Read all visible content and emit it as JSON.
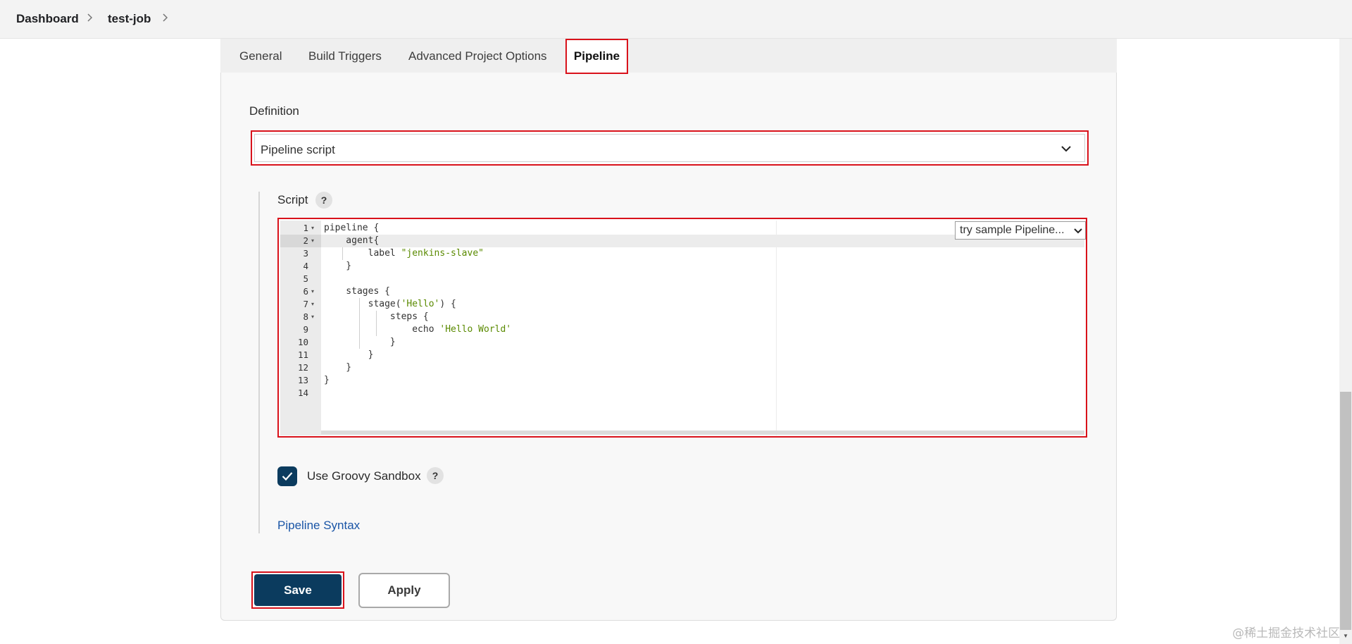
{
  "breadcrumb": {
    "items": [
      "Dashboard",
      "test-job"
    ]
  },
  "tabs": [
    "General",
    "Build Triggers",
    "Advanced Project Options",
    "Pipeline"
  ],
  "active_tab": "Pipeline",
  "definition": {
    "label": "Definition",
    "selected": "Pipeline script"
  },
  "script": {
    "label": "Script",
    "help": "?",
    "sample_select": "try sample Pipeline...",
    "line_numbers": [
      "1",
      "2",
      "3",
      "4",
      "5",
      "6",
      "7",
      "8",
      "9",
      "10",
      "11",
      "12",
      "13",
      "14"
    ],
    "lines": [
      {
        "code": "pipeline {"
      },
      {
        "code": "    agent{"
      },
      {
        "code": "        label ",
        "str": "\"jenkins-slave\""
      },
      {
        "code": "    }"
      },
      {
        "code": ""
      },
      {
        "code": "    stages {"
      },
      {
        "code": "        stage(",
        "str": "'Hello'",
        "tail": ") {"
      },
      {
        "code": "            steps {"
      },
      {
        "code": "                echo ",
        "str": "'Hello World'"
      },
      {
        "code": "            }"
      },
      {
        "code": "        }"
      },
      {
        "code": "    }"
      },
      {
        "code": "}"
      },
      {
        "code": ""
      }
    ]
  },
  "sandbox": {
    "label": "Use Groovy Sandbox",
    "checked": true,
    "help": "?"
  },
  "pipeline_syntax_link": "Pipeline Syntax",
  "buttons": {
    "save": "Save",
    "apply": "Apply"
  },
  "watermark": "@稀土掘金技术社区",
  "colors": {
    "primary": "#0b3b5e",
    "highlight": "#d9121b",
    "link": "#1a55a6",
    "string": "#5a8a00"
  }
}
